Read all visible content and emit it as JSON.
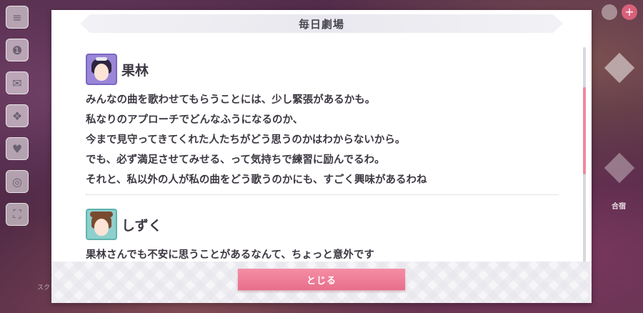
{
  "dialog": {
    "title": "毎日劇場",
    "close_label": "とじる"
  },
  "entries": [
    {
      "speaker": "果林",
      "avatar_icon": "karin-avatar",
      "lines": [
        "みんなの曲を歌わせてもらうことには、少し緊張があるかも。",
        "私なりのアプローチでどんなふうになるのか、",
        "今まで見守ってきてくれた人たちがどう思うのかはわからないから。",
        "でも、必ず満足させてみせる、って気持ちで練習に励んでるわ。",
        "それと、私以外の人が私の曲をどう歌うのかにも、すごく興味があるわね"
      ]
    },
    {
      "speaker": "しずく",
      "avatar_icon": "shizuku-avatar",
      "lines": [
        "果林さんでも不安に思うことがあるなんて、ちょっと意外です"
      ]
    }
  ],
  "background": {
    "right_label": "合宿",
    "bottom_left_label": "スク\nアイ"
  },
  "colors": {
    "accent_pink": "#e86e8a",
    "text": "#3d3842",
    "scroll_thumb": "#ec8aa0"
  }
}
